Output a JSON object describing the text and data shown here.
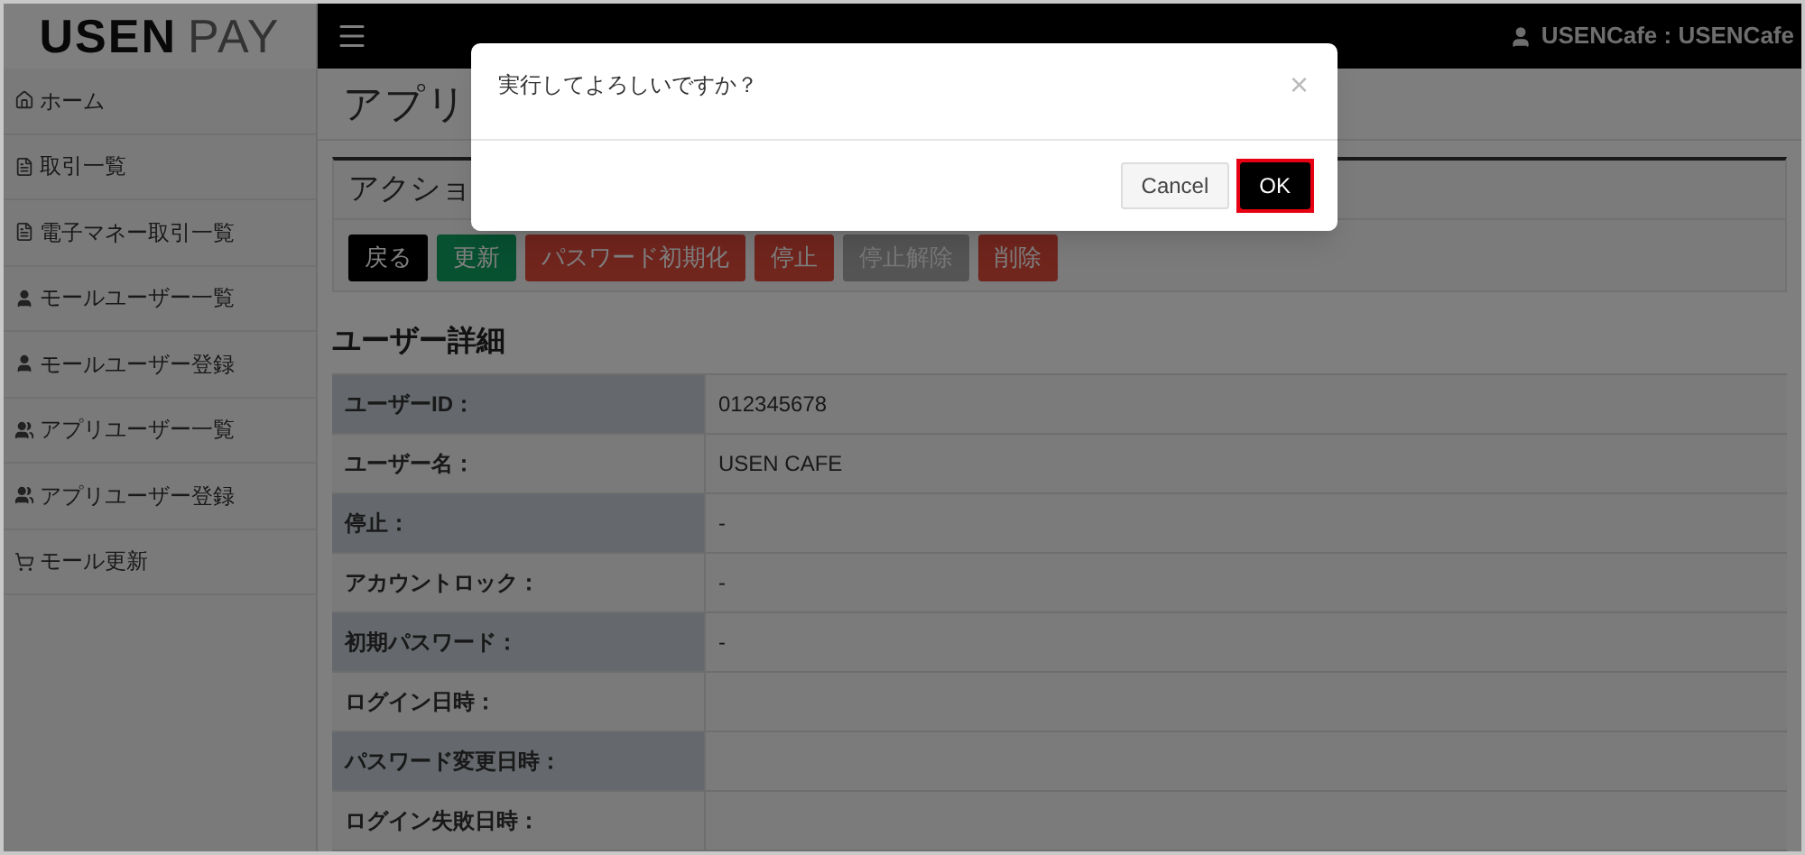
{
  "logo": {
    "bold": "USEN",
    "light": "PAY"
  },
  "sidebar": {
    "items": [
      {
        "label": "ホーム",
        "kind": "home"
      },
      {
        "label": "取引一覧",
        "kind": "document"
      },
      {
        "label": "電子マネー取引一覧",
        "kind": "document"
      },
      {
        "label": "モールユーザー一覧",
        "kind": "user"
      },
      {
        "label": "モールユーザー登録",
        "kind": "user"
      },
      {
        "label": "アプリユーザー一覧",
        "kind": "users"
      },
      {
        "label": "アプリユーザー登録",
        "kind": "users"
      },
      {
        "label": "モール更新",
        "kind": "cart"
      }
    ]
  },
  "navbar": {
    "user": "USENCafe : USENCafe"
  },
  "page_title": "アプリ",
  "action_panel": {
    "title": "アクショ",
    "buttons": [
      {
        "label": "戻る",
        "kind": "dark"
      },
      {
        "label": "更新",
        "kind": "success"
      },
      {
        "label": "パスワード初期化",
        "kind": "danger"
      },
      {
        "label": "停止",
        "kind": "danger"
      },
      {
        "label": "停止解除",
        "kind": "disabled"
      },
      {
        "label": "削除",
        "kind": "danger"
      }
    ]
  },
  "details": {
    "title": "ユーザー詳細",
    "rows": [
      {
        "label": "ユーザーID：",
        "value": "012345678"
      },
      {
        "label": "ユーザー名：",
        "value": "USEN CAFE"
      },
      {
        "label": "停止：",
        "value": "-"
      },
      {
        "label": "アカウントロック：",
        "value": "-"
      },
      {
        "label": "初期パスワード：",
        "value": "-"
      },
      {
        "label": "ログイン日時："
      },
      {
        "label": "パスワード変更日時："
      },
      {
        "label": "ログイン失敗日時："
      }
    ]
  },
  "dialog": {
    "message": "実行してよろしいですか？",
    "close": "×",
    "buttons": [
      {
        "label": "Cancel",
        "kind": "default",
        "highlighted": false
      },
      {
        "label": "OK",
        "kind": "primary",
        "highlighted": true
      }
    ]
  }
}
